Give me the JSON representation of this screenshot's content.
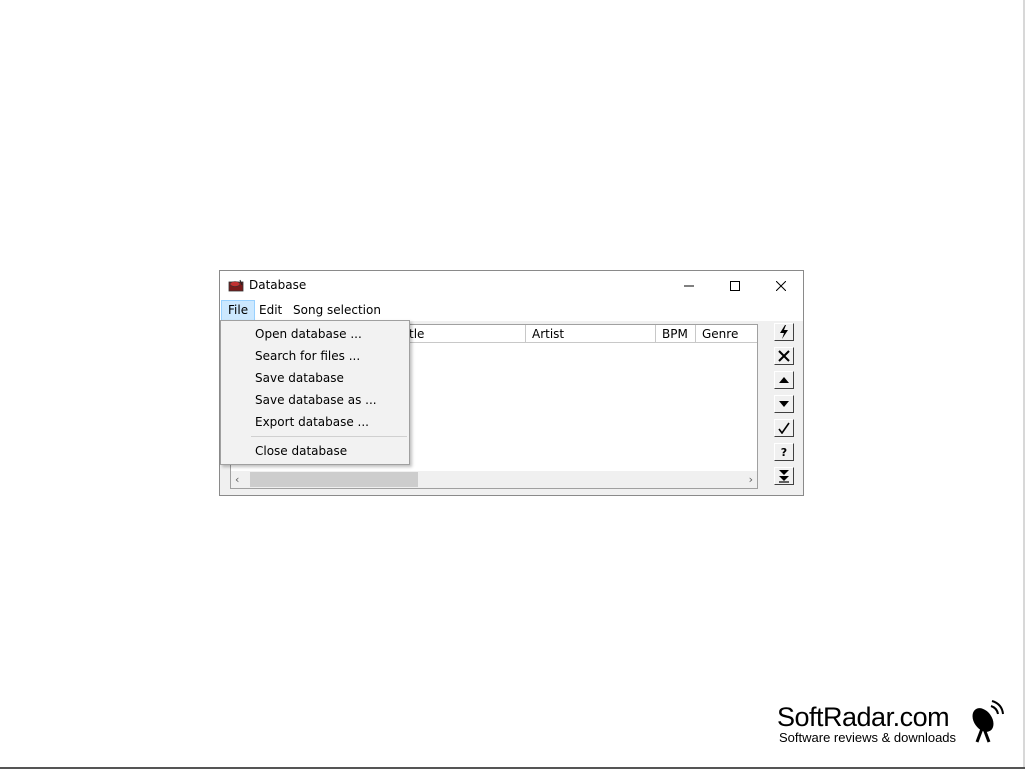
{
  "window": {
    "title": "Database",
    "controls": {
      "minimize": "—",
      "maximize": "☐",
      "close": "✕"
    }
  },
  "menubar": {
    "file": "File",
    "edit": "Edit",
    "song_selection": "Song selection"
  },
  "list": {
    "columns": [
      "tle",
      "Artist",
      "BPM",
      "Genre"
    ]
  },
  "scrollbar": {
    "left_arrow": "‹",
    "right_arrow": "›"
  },
  "toolbar": {
    "icons": [
      "lightning-icon",
      "x-icon",
      "up-arrow-icon",
      "down-arrow-icon",
      "checkmark-icon",
      "question-icon",
      "double-down-arrow-icon"
    ],
    "question_label": "?"
  },
  "file_menu": {
    "items": [
      "Open database ...",
      "Search for files ...",
      "Save database",
      "Save database as ...",
      "Export database ...",
      "Close database"
    ]
  },
  "watermark": {
    "name": "SoftRadar.com",
    "tagline": "Software reviews & downloads"
  }
}
